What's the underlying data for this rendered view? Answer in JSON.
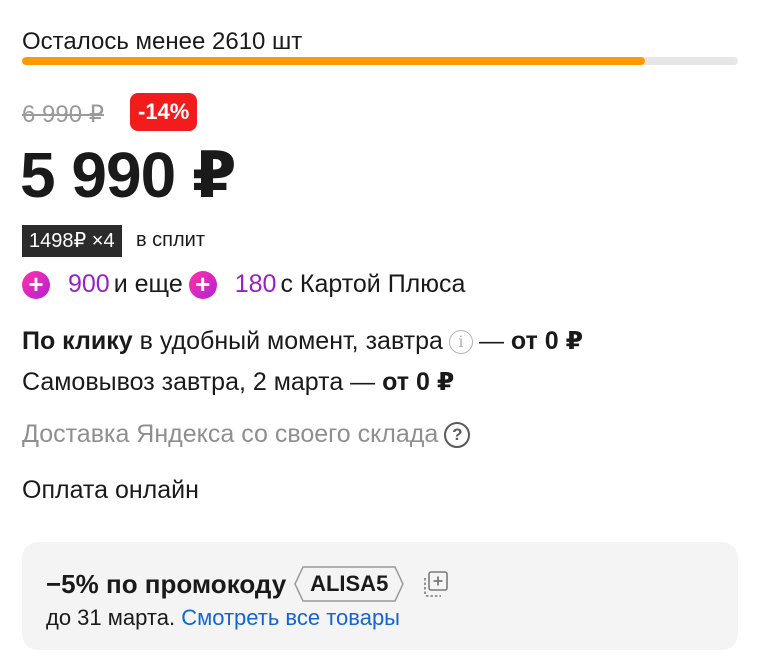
{
  "stock": {
    "text": "Осталось менее 2610 шт",
    "progress": 0.87
  },
  "pricing": {
    "old_price": "6 990 ₽",
    "discount": "-14%",
    "price": "5 990 ₽",
    "split_badge": "1498₽ ×4",
    "split_text": "в сплит"
  },
  "cashback": {
    "amount1": "900",
    "middle": "и еще",
    "amount2": "180",
    "suffix": "с Картой Плюса"
  },
  "delivery": {
    "line1_bold": "По клику",
    "line1_text": "в удобный момент, завтра",
    "line1_dash": "—",
    "line1_price": "от 0 ₽",
    "line2_text": "Самовывоз завтра, 2 марта —",
    "line2_price": "от 0 ₽",
    "line3_text": "Доставка Яндекса со своего склада"
  },
  "payment": "Оплата онлайн",
  "promo": {
    "title": "−5% по промокоду",
    "code": "ALISA5",
    "date_text": "до 31 марта.",
    "link": "Смотреть все товары"
  },
  "colors": {
    "accent": "#ff9900",
    "badge": "#f21c1c",
    "plus": "#9a1fc8",
    "link": "#1464d2"
  },
  "icons": [
    "plus-points-icon",
    "info-icon",
    "help-icon",
    "copy-icon"
  ]
}
